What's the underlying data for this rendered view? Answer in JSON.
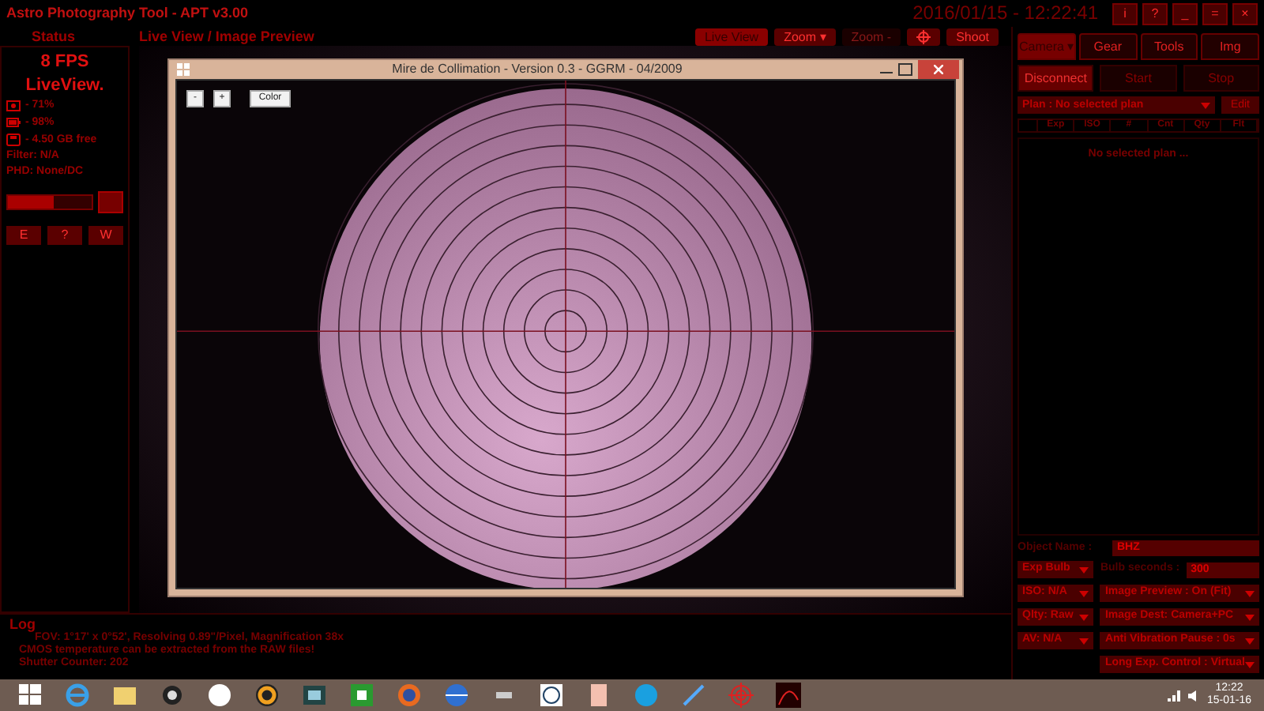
{
  "app": {
    "title": "Astro Photography Tool - APT v3.00",
    "datetime": "2016/01/15 - 12:22:41",
    "window_buttons": [
      "i",
      "?",
      "_",
      "=",
      "×"
    ]
  },
  "status": {
    "heading": "Status",
    "fps": "8 FPS",
    "mode": "LiveView.",
    "stats": [
      {
        "kind": "camera",
        "text": "- 71%"
      },
      {
        "kind": "battery",
        "text": "- 98%"
      },
      {
        "kind": "disk",
        "text": "- 4.50 GB free"
      }
    ],
    "lines": [
      "Filter: N/A",
      "PHD: None/DC"
    ],
    "slider": {
      "level": 0.55
    },
    "nav_buttons": [
      "E",
      "?",
      "W"
    ]
  },
  "preview": {
    "heading": "Live View / Image Preview",
    "buttons": [
      {
        "kind": "text",
        "label": "Live View",
        "selected": true,
        "disabled": false
      },
      {
        "kind": "text",
        "label": "Zoom ▾",
        "selected": false,
        "disabled": false
      },
      {
        "kind": "text",
        "label": "Zoom -",
        "selected": false,
        "disabled": true
      },
      {
        "kind": "icon",
        "selected": false,
        "disabled": false
      },
      {
        "kind": "text",
        "label": "Shoot",
        "selected": false,
        "disabled": false
      }
    ],
    "collimation_window": {
      "title": "Mire de Collimation - Version 0.3 - GGRM - 04/2009",
      "buttons": [
        "-",
        "+",
        "Color"
      ]
    }
  },
  "log": {
    "heading": "Log",
    "lines": [
      "FOV: 1°17' x 0°52', Resolving 0.89\"/Pixel, Magnification 38x",
      "CMOS temperature can be extracted from the RAW files!",
      "Shutter Counter: 202"
    ]
  },
  "right_panel": {
    "tabs": [
      {
        "label": "Camera ▾",
        "selected": true
      },
      {
        "label": "Gear",
        "selected": false
      },
      {
        "label": "Tools",
        "selected": false
      },
      {
        "label": "Img",
        "selected": false
      }
    ],
    "buttons": [
      "Disconnect",
      "Start",
      "Stop"
    ],
    "plan": {
      "value": "Plan : No selected plan",
      "edit": "Edit"
    },
    "table": {
      "columns": [
        "Exp",
        "ISO",
        "#",
        "Cnt",
        "Qty",
        "Flt"
      ],
      "empty": "No selected plan ..."
    },
    "object_name": {
      "label": "Object Name :",
      "value": "BHZ"
    },
    "left_dropdowns": [
      "Exp Bulb",
      "ISO: N/A",
      "Qlty: Raw",
      "AV: N/A"
    ],
    "bulb_seconds": {
      "label": "Bulb seconds :",
      "value": "300"
    },
    "right_dropdowns": [
      "Image Preview : On (Fit)",
      "Image Dest: Camera+PC",
      "Anti Vibration Pause : 0s",
      "Long Exp. Control : Virtual"
    ]
  },
  "taskbar": {
    "time": "12:22",
    "date": "15-01-16"
  }
}
